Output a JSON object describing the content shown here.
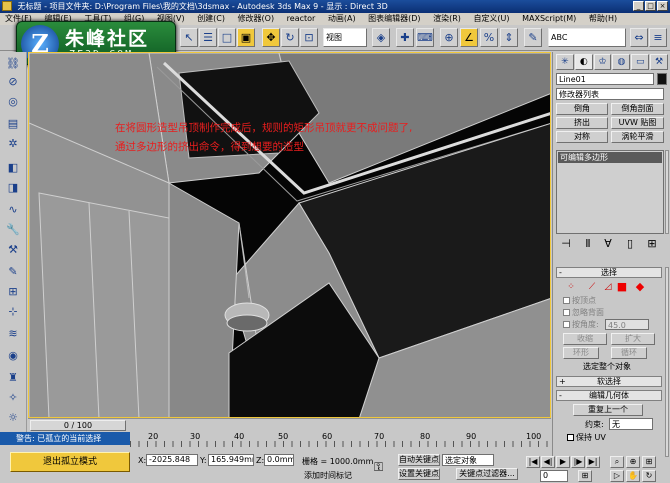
{
  "titlebar": {
    "title": "无标题    - 项目文件夹: D:\\Program Files\\我的文档\\3dsmax    - Autodesk 3ds Max 9        - 显示 : Direct 3D"
  },
  "menu": [
    "文件(F)",
    "编辑(E)",
    "工具(T)",
    "组(G)",
    "视图(V)",
    "创建(C)",
    "修改器(O)",
    "reactor",
    "动画(A)",
    "图表编辑器(D)",
    "渲染(R)",
    "自定义(U)",
    "MAXScript(M)",
    "帮助(H)"
  ],
  "logo": {
    "cn": "朱峰社区",
    "en": "ZF3D.COM",
    "mark": "Z"
  },
  "toolbar": {
    "viewport_dropdown": "视图",
    "selection_dropdown": "ABC"
  },
  "viewport": {
    "annotation_line1": "在将圆形造型吊顶制作完成后，规则的矩形吊顶就更不成问题了,",
    "annotation_line2": "通过多边形的挤出命令，得到想要的造型"
  },
  "panel": {
    "object_name": "Line01",
    "modifier_list": "修改器列表",
    "buttons": {
      "chamfer": "倒角",
      "chamfer_profile": "倒角剖面",
      "extrude": "挤出",
      "uvw_map": "UVW 贴图",
      "symmetry": "对称",
      "tweak_smooth": "涡轮平滑"
    },
    "stack_item": "可编辑多边形",
    "selection": {
      "title": "选择",
      "by_vertex": "按顶点",
      "ignore_backfacing": "忽略背面",
      "by_angle": "按角度:",
      "angle_value": "45.0",
      "shrink": "收缩",
      "grow": "扩大",
      "ring": "环形",
      "loop": "循环",
      "status": "选定整个对象"
    },
    "soft_selection": "软选择",
    "edit_geometry": {
      "title": "编辑几何体",
      "repeat_last": "重复上一个",
      "constraints_label": "约束:",
      "constraints_value": "无",
      "preserve_uv": "保持 UV"
    }
  },
  "timeline": {
    "frame_label": "0 / 100",
    "ticks": [
      "20",
      "30",
      "40",
      "50",
      "60",
      "70",
      "80",
      "90",
      "100"
    ]
  },
  "status": {
    "message": "警告: 已孤立的当前选择",
    "exit_isolation": "退出孤立模式",
    "x_label": "X:",
    "x_value": "-2025.848",
    "y_label": "Y:",
    "y_value": "165.949mm",
    "z_label": "Z:",
    "z_value": "0.0mm",
    "grid": "栅格 = 1000.0mm",
    "add_time_tag": "添加时间标记",
    "auto_key": "自动关键点",
    "set_key": "设置关键点",
    "selected_object": "选定对象",
    "key_filters": "关键点过滤器...",
    "frame_value": "0"
  },
  "colors": {
    "annotation": "#e81e1e",
    "active_highlight": "#f0c83c",
    "title_bar": "#0b2f73"
  }
}
